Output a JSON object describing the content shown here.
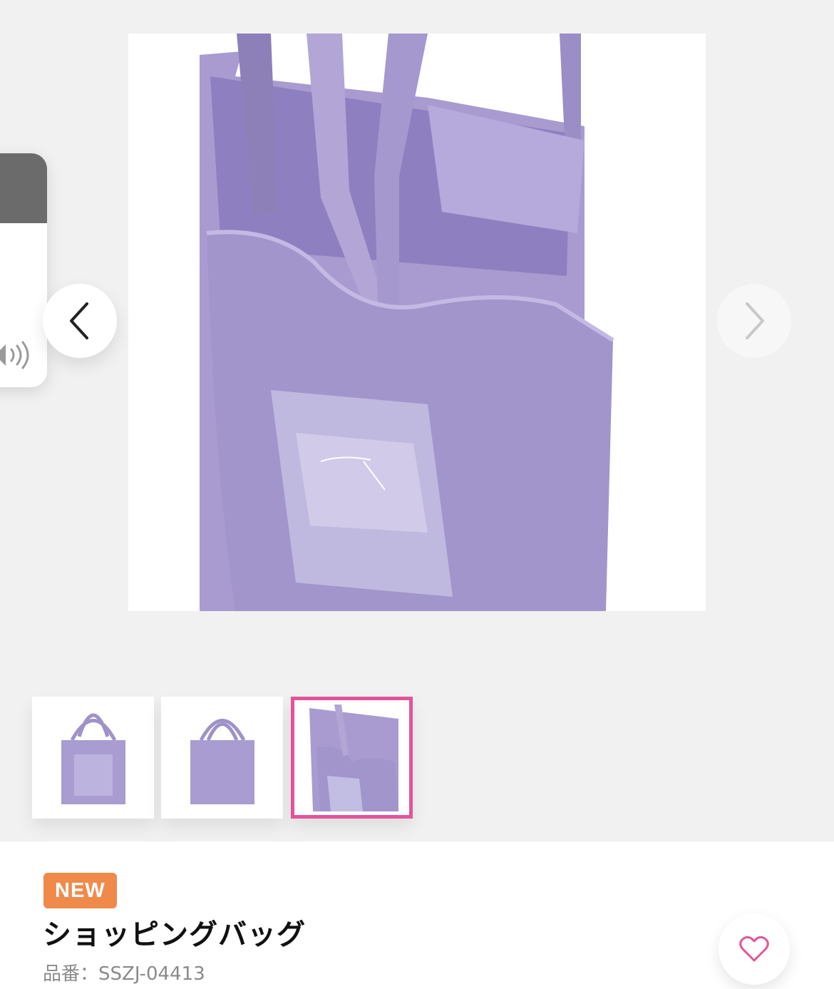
{
  "gallery": {
    "main_image_alt": "",
    "thumbnails": [
      {
        "selected": false
      },
      {
        "selected": false
      },
      {
        "selected": true
      }
    ],
    "accent_color": "#e2549a",
    "icons": {
      "prev": "chevron-left-icon",
      "next": "chevron-right-icon",
      "volume": "speaker-icon"
    }
  },
  "product": {
    "badge": "NEW",
    "badge_color": "#f08a4b",
    "name": "ショッピングバッグ",
    "sku": "品番：SSZJ-04413",
    "favorite_icon": "heart-icon"
  }
}
